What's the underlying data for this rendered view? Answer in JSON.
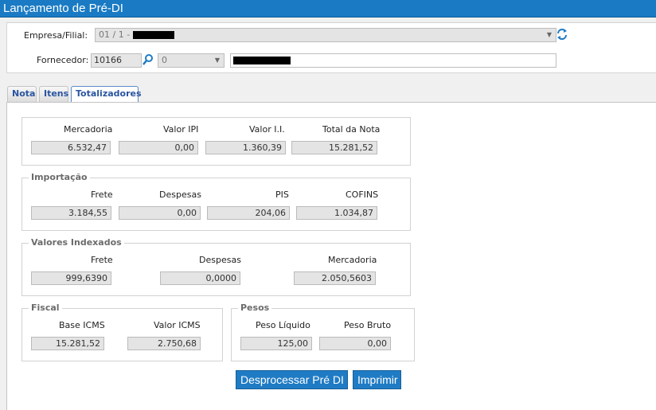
{
  "window": {
    "title": "Lançamento de Pré-DI"
  },
  "header": {
    "empresa_label": "Empresa/Filial:",
    "empresa_value": "01 / 1 -",
    "fornecedor_label": "Fornecedor:",
    "fornecedor_code": "10166",
    "fornecedor_select": "0"
  },
  "tabs": [
    {
      "label": "Nota"
    },
    {
      "label": "Itens"
    },
    {
      "label": "Totalizadores"
    }
  ],
  "totais": {
    "labels": [
      "Mercadoria",
      "Valor IPI",
      "Valor I.I.",
      "Total da Nota"
    ],
    "values": [
      "6.532,47",
      "0,00",
      "1.360,39",
      "15.281,52"
    ]
  },
  "importacao": {
    "title": "Importação",
    "labels": [
      "Frete",
      "Despesas",
      "PIS",
      "COFINS"
    ],
    "values": [
      "3.184,55",
      "0,00",
      "204,06",
      "1.034,87"
    ]
  },
  "indexados": {
    "title": "Valores Indexados",
    "labels": [
      "Frete",
      "Despesas",
      "Mercadoria"
    ],
    "values": [
      "999,6390",
      "0,0000",
      "2.050,5603"
    ]
  },
  "fiscal": {
    "title": "Fiscal",
    "labels": [
      "Base ICMS",
      "Valor ICMS"
    ],
    "values": [
      "15.281,52",
      "2.750,68"
    ]
  },
  "pesos": {
    "title": "Pesos",
    "labels": [
      "Peso Líquido",
      "Peso Bruto"
    ],
    "values": [
      "125,00",
      "0,00"
    ]
  },
  "actions": {
    "desprocessar": "Desprocessar Pré DI",
    "imprimir": "Imprimir"
  },
  "icons": [
    "refresh-icon",
    "search-icon",
    "chevron-down-icon"
  ],
  "colors": {
    "titlebar": "#1a7bc4",
    "button": "#1f7bc4",
    "tab_text": "#2a55a0"
  }
}
